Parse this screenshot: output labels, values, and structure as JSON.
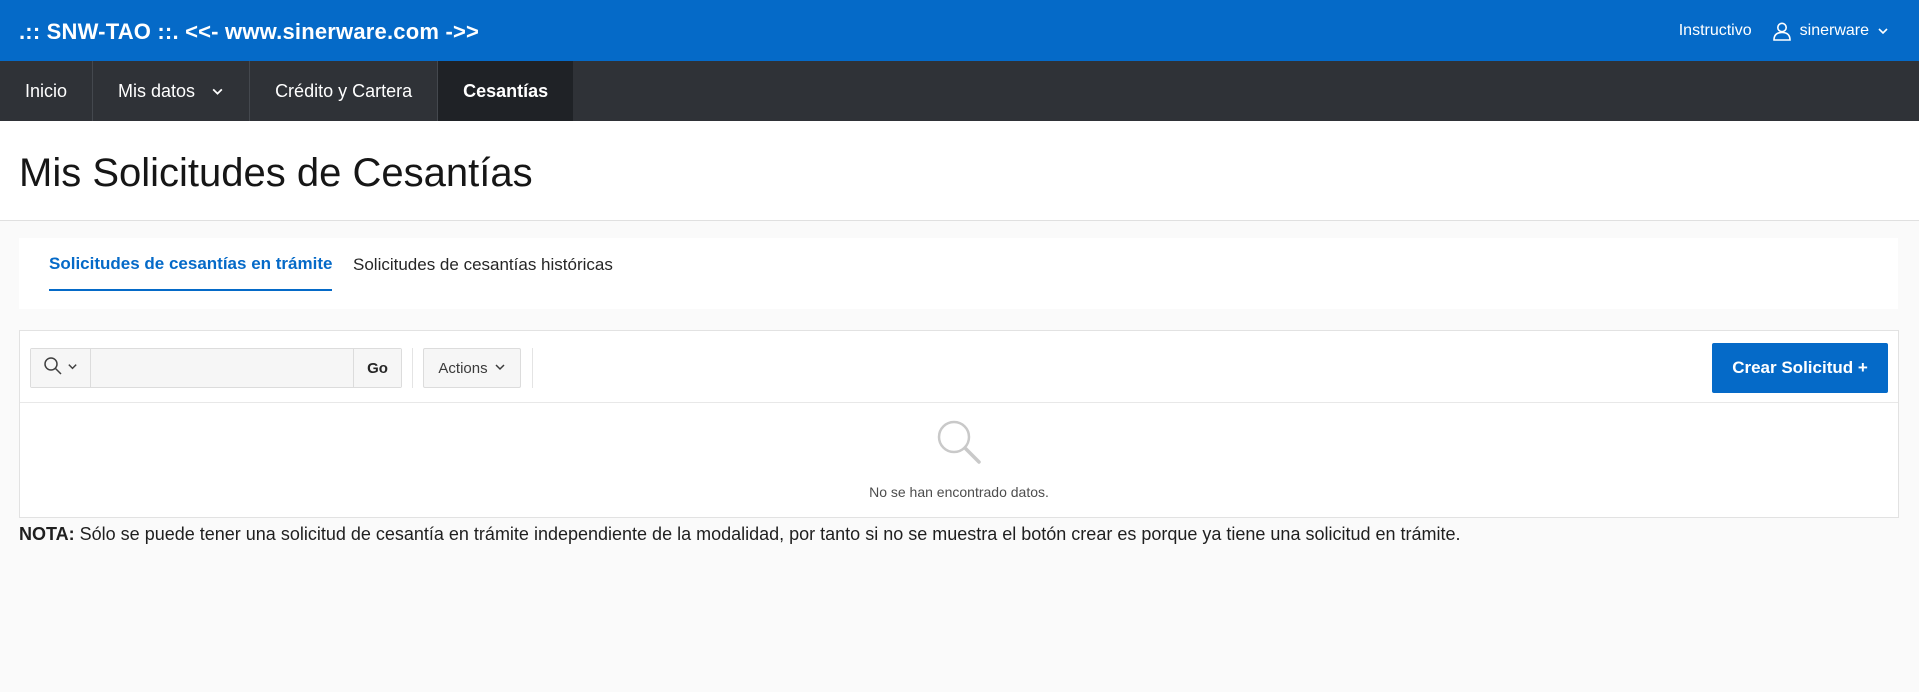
{
  "header": {
    "app_title": ".:: SNW-TAO ::. <<- www.sinerware.com ->>",
    "instructivo_label": "Instructivo",
    "user_label": "sinerware"
  },
  "nav": {
    "items": [
      {
        "label": "Inicio"
      },
      {
        "label": "Mis datos"
      },
      {
        "label": "Crédito y Cartera"
      },
      {
        "label": "Cesantías"
      }
    ]
  },
  "page": {
    "title": "Mis Solicitudes de Cesantías"
  },
  "tabs": [
    {
      "label": "Solicitudes de cesantías en trámite"
    },
    {
      "label": "Solicitudes de cesantías históricas"
    }
  ],
  "report": {
    "search_value": "",
    "go_label": "Go",
    "actions_label": "Actions",
    "create_label": "Crear Solicitud +",
    "no_data_text": "No se han encontrado datos."
  },
  "note": {
    "label": "NOTA:",
    "text": " Sólo se puede tener una solicitud de cesantía en trámite independiente de la modalidad, por tanto si no se muestra el botón crear es porque ya tiene una solicitud en trámite."
  },
  "colors": {
    "brand_blue": "#056ac8",
    "nav_dark": "#2f3237",
    "nav_active": "#1f2226"
  }
}
